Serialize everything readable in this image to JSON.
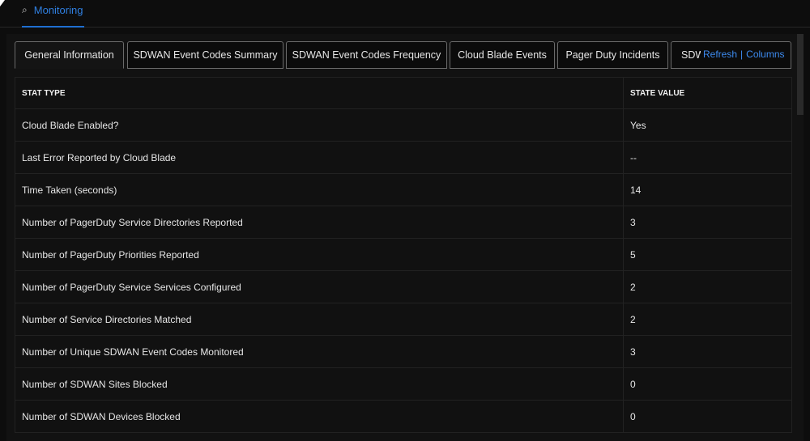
{
  "nav": {
    "label": "Monitoring",
    "icon": "search-icon"
  },
  "tabs": [
    "General Information",
    "SDWAN Event Codes Summary",
    "SDWAN Event Codes Frequency",
    "Cloud Blade Events",
    "Pager Duty Incidents",
    "SDWAN Incident State"
  ],
  "links": {
    "refresh": "Refresh",
    "sep": "|",
    "columns": "Columns"
  },
  "table": {
    "headers": [
      "STAT TYPE",
      "STATE VALUE"
    ],
    "rows": [
      [
        "Cloud Blade Enabled?",
        "Yes"
      ],
      [
        "Last Error Reported by Cloud Blade",
        "--"
      ],
      [
        "Time Taken (seconds)",
        "14"
      ],
      [
        "Number of PagerDuty Service Directories Reported",
        "3"
      ],
      [
        "Number of PagerDuty Priorities Reported",
        "5"
      ],
      [
        "Number of PagerDuty Service Services Configured",
        "2"
      ],
      [
        "Number of Service Directories Matched",
        "2"
      ],
      [
        "Number of Unique SDWAN Event Codes Monitored",
        "3"
      ],
      [
        "Number of SDWAN Sites Blocked",
        "0"
      ],
      [
        "Number of SDWAN Devices Blocked",
        "0"
      ]
    ]
  }
}
